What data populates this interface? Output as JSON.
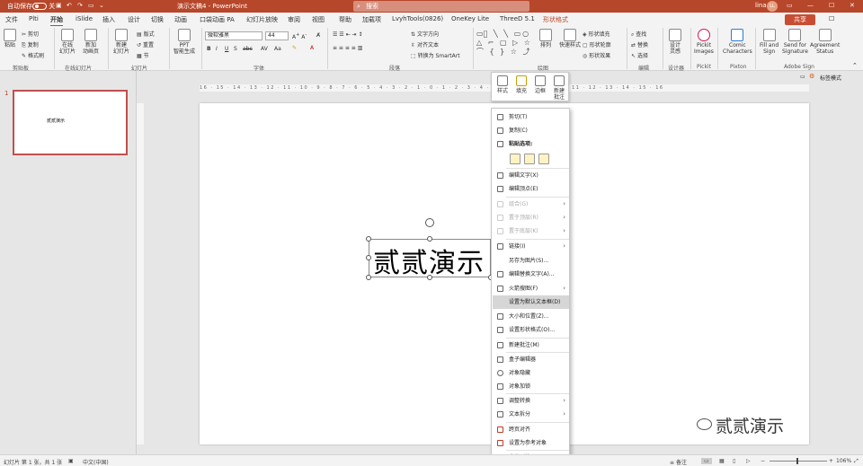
{
  "titlebar": {
    "autosave": "自动保存",
    "autosave_state": "关",
    "doc_title": "演示文稿4  -  PowerPoint",
    "search": "搜索",
    "user": "lina",
    "user_initials": "LL"
  },
  "tabs": [
    "文件",
    "Plti",
    "开始",
    "iSlide",
    "插入",
    "设计",
    "切换",
    "动画",
    "口袋动画 PA",
    "幻灯片放映",
    "审阅",
    "视图",
    "帮助",
    "加载项",
    "LvyhTools(0826)",
    "OneKey Lite",
    "ThreeD 5.1",
    "形状格式"
  ],
  "share_label": "共享",
  "ribbon": {
    "paste": "粘贴",
    "cut": "剪切",
    "copy": "复制",
    "format_painter": "格式刷",
    "clipboard": "剪贴板",
    "online_ppt": "在线\n幻灯片",
    "add_anim": "新加\n动画页",
    "online_group": "在线幻灯片",
    "new_slide": "新建\n幻灯片",
    "layout": "版式",
    "reset": "重置",
    "section": "节",
    "slides_group": "幻灯片",
    "ppt_smart": "PPT\n智能生成",
    "font_name": "微软雅黑",
    "font_size": "44",
    "font_group": "字体",
    "text_dir": "文字方向",
    "align_text": "对齐文本",
    "smartart": "转换为 SmartArt",
    "para_group": "段落",
    "arrange": "排列",
    "quick_styles": "快速样式",
    "shape_fill": "形状填充",
    "shape_outline": "形状轮廓",
    "shape_effects": "形状效果",
    "drawing_group": "绘图",
    "find": "查找",
    "replace": "替换",
    "select": "选择",
    "edit_group": "编辑",
    "designer": "设计\n灵感",
    "designer_group": "设计器",
    "pickit": "Pickit\nImages",
    "pickit_group": "Pickit",
    "comic": "Comic\nCharacters",
    "pixton_group": "Pixton",
    "fill_sign": "Fill and\nSign",
    "send_sig": "Send for\nSignature",
    "agreement": "Agreement\nStatus",
    "adobe_group": "Adobe Sign",
    "ruler_mode": "标签模式"
  },
  "thumb": {
    "number": "1",
    "text": "贰贰演示"
  },
  "slide_text": "贰贰演示",
  "ruler_h": "16 · 15 · 14 · 13 · 12 · 11 · 10 · 9 · 8 · 7 · 6 · 5 · 4 · 3 · 2 · 1 · 0 · 1 · 2 · 3 · 4 · 5 · 6 · 7 · 8 · 9 · 10 · 11 · 12 · 13 · 14 · 15 · 16",
  "minitoolbar": [
    "样式",
    "填充",
    "边框",
    "新建\n批注"
  ],
  "menu": {
    "cut": "剪切(T)",
    "copy": "复制(C)",
    "paste_options": "粘贴选项:",
    "edit_text": "编辑文字(X)",
    "edit_points": "编辑顶点(E)",
    "group": "组合(G)",
    "bring_front": "置于顶层(R)",
    "send_back": "置于底层(K)",
    "link": "链接(I)",
    "save_pic": "另存为图片(S)...",
    "alt_text": "编辑替换文字(A)...",
    "smart_lookup": "火箭搜图(F)",
    "set_default": "设置为默认文本框(D)",
    "size_pos": "大小和位置(Z)...",
    "format_shape": "设置形状格式(O)...",
    "new_comment": "新建批注(M)",
    "box_editor": "盒子编辑器",
    "hide_obj": "对象隐藏",
    "lock_obj": "对象加锁",
    "adjust_convert": "调整转换",
    "text_split": "文本拆分",
    "cross_align": "跨页对齐",
    "set_ref": "设置为参考对象",
    "fav_shape": "收藏形状"
  },
  "status": {
    "slide": "幻灯片 第 1 张，共 1 张",
    "lang": "中文(中国)",
    "notes": "备注",
    "zoom": "106%"
  },
  "watermark": "贰贰演示",
  "colors": {
    "accent": "#b7472a",
    "ctx": "#b7472a"
  }
}
